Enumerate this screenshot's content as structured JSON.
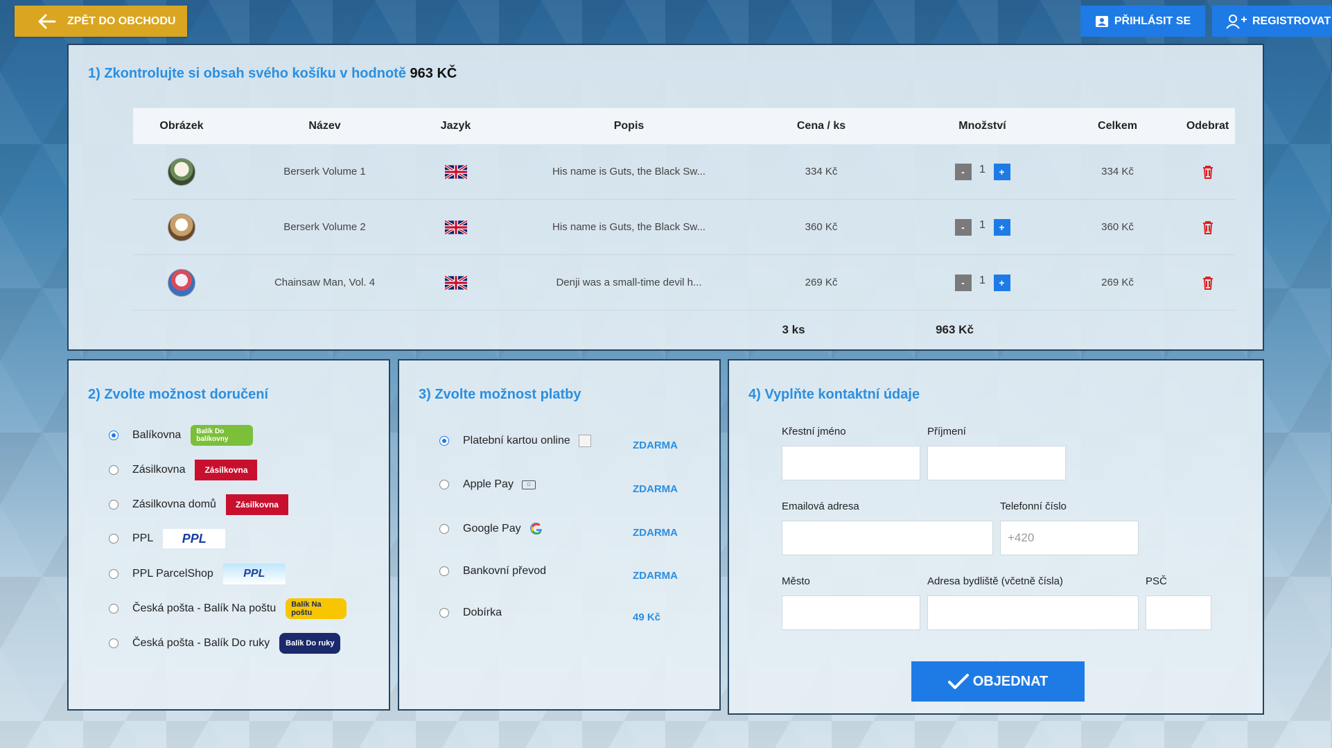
{
  "header": {
    "back_label": "ZPĚT DO OBCHODU",
    "login_label": "PŘIHLÁSIT SE",
    "register_label": "REGISTROVAT"
  },
  "cart": {
    "title_prefix": "1) Zkontrolujte si obsah svého košíku v hodnotě",
    "title_value": "963 KČ",
    "columns": [
      "Obrázek",
      "Název",
      "Jazyk",
      "Popis",
      "Cena / ks",
      "Množství",
      "Celkem",
      "Odebrat"
    ],
    "items": [
      {
        "name": "Berserk Volume 1",
        "description": "His name is Guts, the Black Sw...",
        "price": "334 Kč",
        "quantity": "1",
        "total": "334 Kč"
      },
      {
        "name": "Berserk Volume 2",
        "description": "His name is Guts, the Black Sw...",
        "price": "360 Kč",
        "quantity": "1",
        "total": "360 Kč"
      },
      {
        "name": "Chainsaw Man, Vol. 4",
        "description": "Denji was a small-time devil h...",
        "price": "269 Kč",
        "quantity": "1",
        "total": "269 Kč"
      }
    ],
    "summary_count": "3 ks",
    "summary_total": "963 Kč",
    "minus_label": "-",
    "plus_label": "+"
  },
  "delivery": {
    "title": "2) Zvolte možnost doručení",
    "options": [
      {
        "label": "Balíkovna",
        "logo": "Balík Do balíkovny",
        "checked": true
      },
      {
        "label": "Zásilkovna",
        "logo": "Zásilkovna",
        "checked": false
      },
      {
        "label": "Zásilkovna domů",
        "logo": "Zásilkovna",
        "checked": false
      },
      {
        "label": "PPL",
        "logo": "PPL",
        "checked": false
      },
      {
        "label": "PPL ParcelShop",
        "logo": "PPL",
        "checked": false
      },
      {
        "label": "Česká pošta - Balík Na poštu",
        "logo": "Balík Na poštu",
        "checked": false
      },
      {
        "label": "Česká pošta - Balík Do ruky",
        "logo": "Balík Do ruky",
        "checked": false
      }
    ]
  },
  "payment": {
    "title": "3) Zvolte možnost platby",
    "options": [
      {
        "label": "Platební kartou online",
        "price": "ZDARMA",
        "checked": true
      },
      {
        "label": "Apple Pay",
        "price": "ZDARMA",
        "checked": false
      },
      {
        "label": "Google Pay",
        "price": "ZDARMA",
        "checked": false
      },
      {
        "label": "Bankovní převod",
        "price": "ZDARMA",
        "checked": false
      },
      {
        "label": "Dobírka",
        "price": "49 Kč",
        "checked": false
      }
    ]
  },
  "contact": {
    "title": "4) Vyplňte kontaktní údaje",
    "first_name_label": "Křestní jméno",
    "last_name_label": "Příjmení",
    "email_label": "Emailová adresa",
    "phone_label": "Telefonní číslo",
    "phone_placeholder": "+420",
    "city_label": "Město",
    "address_label": "Adresa bydliště (včetně čísla)",
    "zip_label": "PSČ",
    "order_label": "OBJEDNAT"
  },
  "colors": {
    "accent": "#1e7be6",
    "back_button": "#daa520",
    "title": "#2a8fe0",
    "remove": "#e02020"
  }
}
